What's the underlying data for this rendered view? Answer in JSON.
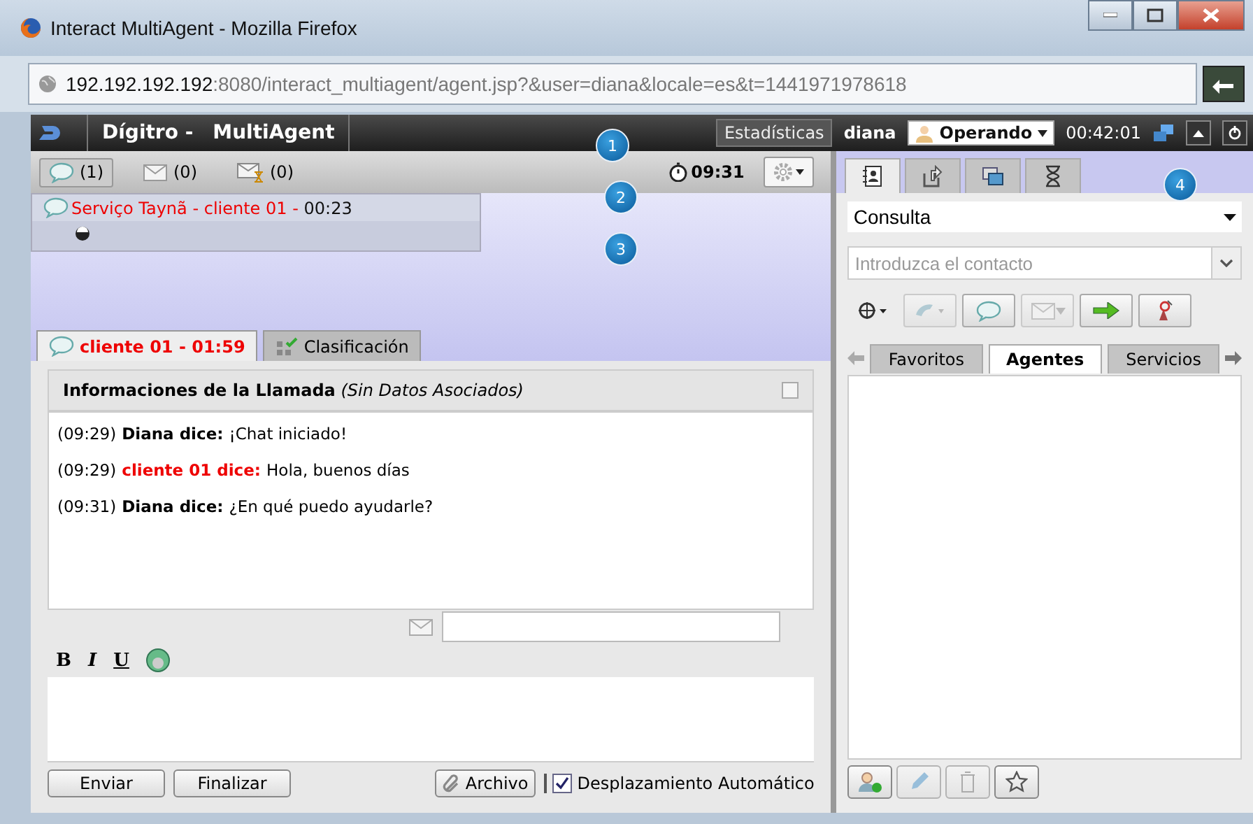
{
  "window": {
    "title": "Interact MultiAgent - Mozilla Firefox",
    "url_host": "192.192.192.192",
    "url_rest": ":8080/interact_multiagent/agent.jsp?&user=diana&locale=es&t=1441971978618"
  },
  "header": {
    "brand": "Dígitro -",
    "product": "MultiAgent",
    "stats_button": "Estadísticas",
    "user": "diana",
    "status": "Operando",
    "time": "00:42:01"
  },
  "counters": [
    {
      "kind": "chat",
      "count": "(1)",
      "selected": true
    },
    {
      "kind": "mail",
      "count": "(0)",
      "selected": false
    },
    {
      "kind": "mail_queue",
      "count": "(0)",
      "selected": false
    }
  ],
  "timer": "09:31",
  "queue_item": {
    "title": "Serviço Taynã - cliente 01 -",
    "time": "00:23"
  },
  "chat_tabs": [
    {
      "kind": "chat",
      "label": "cliente 01 - 01:59",
      "selected": true
    },
    {
      "kind": "classification",
      "label": "Clasificación",
      "selected": false
    }
  ],
  "info_header": "**Informaciones de la Llamada** *(Sin Datos Asociados)*",
  "messages": [
    {
      "time": "(09:29)",
      "speaker": "Diana dice:",
      "kind": "agent",
      "text": "¡Chat iniciado!"
    },
    {
      "time": "(09:29)",
      "speaker": "cliente 01 dice:",
      "kind": "client",
      "text": "Hola, buenos días"
    },
    {
      "time": "(09:31)",
      "speaker": "Diana dice:",
      "kind": "agent",
      "text": "¿En qué puedo ayudarle?"
    }
  ],
  "format_buttons": [
    "B",
    "I",
    "U"
  ],
  "buttons": {
    "send": "Enviar",
    "finish": "Finalizar",
    "attach": "Archivo"
  },
  "auto_scroll": {
    "label": "Desplazamiento Automático",
    "checked": true
  },
  "side_tabs": [
    {
      "kind": "contacts",
      "selected": true
    },
    {
      "kind": "transfer",
      "selected": false
    },
    {
      "kind": "messages",
      "selected": false
    },
    {
      "kind": "history",
      "selected": false
    }
  ],
  "consult_select": "Consulta",
  "contact_field": {
    "placeholder": "Introduzca el contacto"
  },
  "side_toolbar": [
    {
      "kind": "target",
      "disabled": false
    },
    {
      "kind": "phone",
      "disabled": true
    },
    {
      "kind": "chat",
      "disabled": false
    },
    {
      "kind": "mail",
      "disabled": true
    },
    {
      "kind": "forward",
      "disabled": false
    },
    {
      "kind": "antenna",
      "disabled": false
    }
  ],
  "list_tabs": [
    {
      "label": "Favoritos",
      "selected": false
    },
    {
      "label": "Agentes",
      "selected": true
    },
    {
      "label": "Servicios",
      "selected": false
    }
  ],
  "list_actions": [
    {
      "kind": "add_user",
      "disabled": false
    },
    {
      "kind": "edit",
      "disabled": true
    },
    {
      "kind": "delete",
      "disabled": true
    },
    {
      "kind": "favorite",
      "disabled": false
    }
  ],
  "callouts": [
    "1",
    "2",
    "3",
    "4"
  ]
}
